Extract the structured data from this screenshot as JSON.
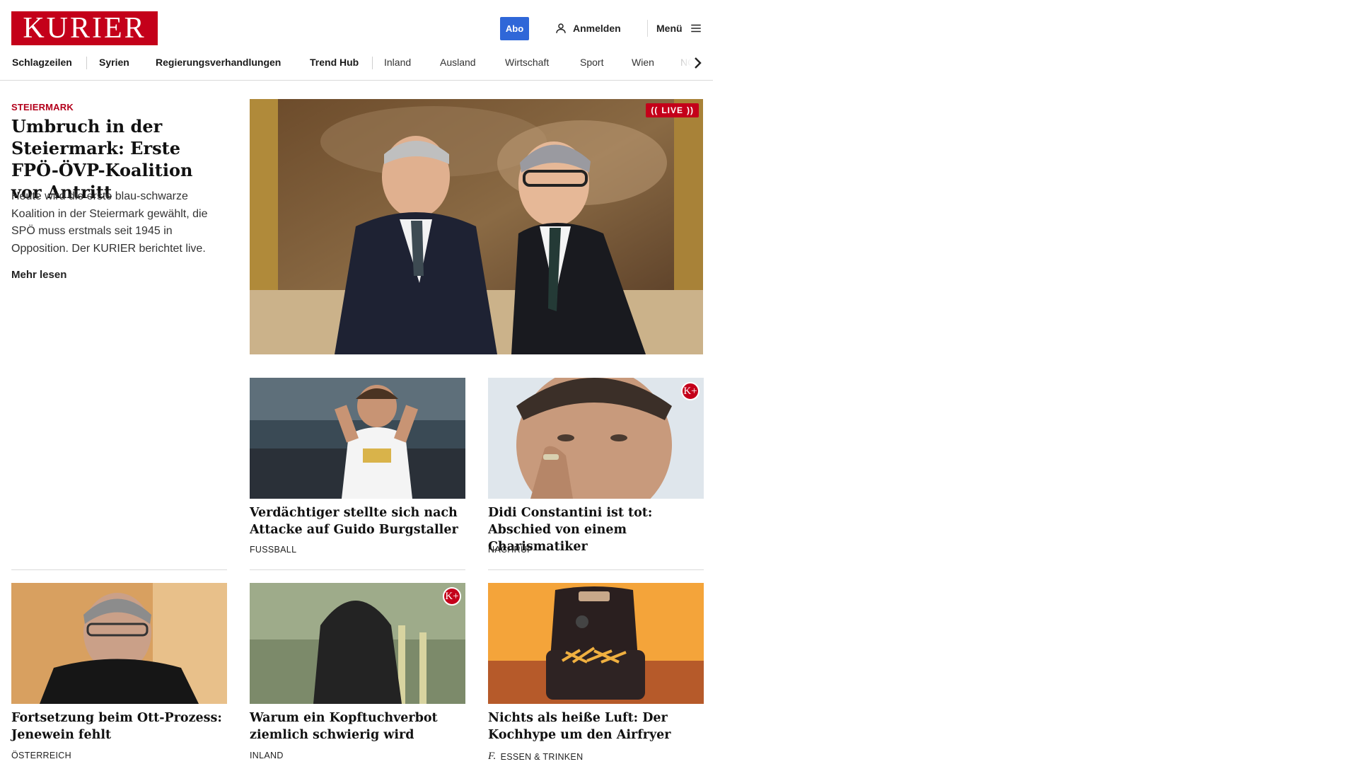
{
  "brand": {
    "logo_text": "KURIER",
    "accent": "#c4001a",
    "abo_color": "#2f67d8"
  },
  "header": {
    "abo_label": "Abo",
    "login_label": "Anmelden",
    "menu_label": "Menü"
  },
  "nav": {
    "items": [
      "Schlagzeilen",
      "Syrien",
      "Regierungsverhandlungen",
      "Trend Hub",
      "Inland",
      "Ausland",
      "Wirtschaft",
      "Sport",
      "Wien",
      "NÖ"
    ]
  },
  "lead": {
    "kicker": "STEIERMARK",
    "title": "Umbruch in der Steier­mark: Erste FPÖ-ÖVP-Ko­alition vor Antritt",
    "teaser": "Heute wird die erste blau-schwarze Koalition in der Steiermark gewählt, die SPÖ muss erstmals seit 1945 in Opposition. Der KURIER berichtet live.",
    "more_label": "Mehr lesen",
    "live_badge": "LIVE"
  },
  "cards": [
    {
      "title": "Verdächtiger stellte sich nach Atta­cke auf Guido Burgstaller",
      "category": "FUSSBALL",
      "premium": false
    },
    {
      "title": "Didi Constantini ist tot: Abschied von einem Charismatiker",
      "category": "NACHRUF",
      "premium": true,
      "premium_badge": "K+"
    },
    {
      "title": "Fortsetzung beim Ott-Prozess: Je­newein fehlt",
      "category": "ÖSTERREICH",
      "premium": false
    },
    {
      "title": "Warum ein Kopftuchverbot ziem­lich schwierig wird",
      "category": "INLAND",
      "premium": true,
      "premium_badge": "K+"
    },
    {
      "title": "Nichts als heiße Luft: Der Koch­hype um den Airfryer",
      "category": "ESSEN & TRINKEN",
      "premium": false,
      "category_icon": "f."
    }
  ]
}
